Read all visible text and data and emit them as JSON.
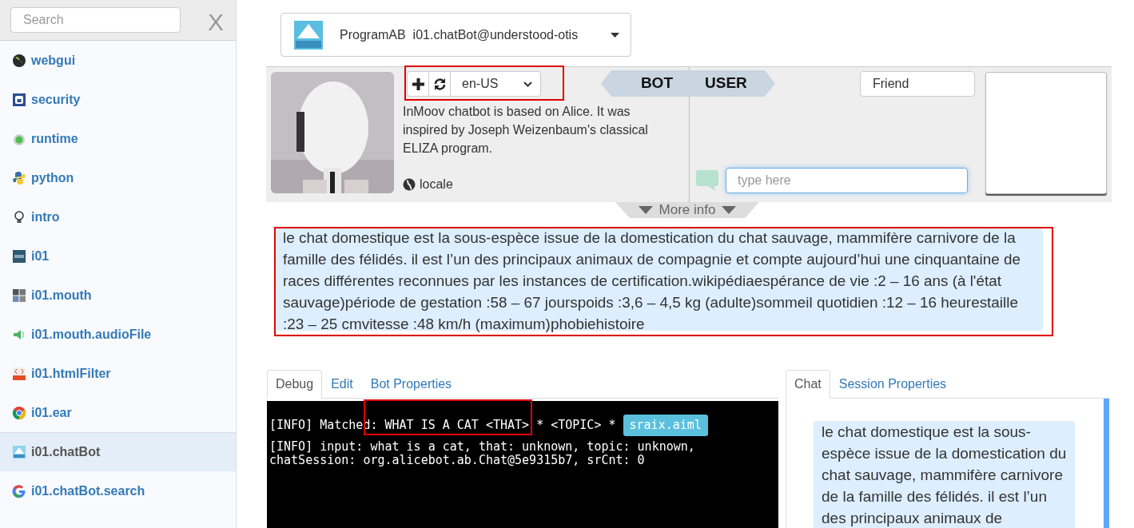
{
  "sidebar": {
    "search": {
      "placeholder": "Search"
    },
    "close": "X",
    "items": [
      {
        "label": "webgui",
        "selected": false
      },
      {
        "label": "security",
        "selected": false
      },
      {
        "label": "runtime",
        "selected": false
      },
      {
        "label": "python",
        "selected": false
      },
      {
        "label": "intro",
        "selected": false
      },
      {
        "label": "i01",
        "selected": false
      },
      {
        "label": "i01.mouth",
        "selected": false
      },
      {
        "label": "i01.mouth.audioFile",
        "selected": false
      },
      {
        "label": "i01.htmlFilter",
        "selected": false
      },
      {
        "label": "i01.ear",
        "selected": false
      },
      {
        "label": "i01.chatBot",
        "selected": true
      },
      {
        "label": "i01.chatBot.search",
        "selected": false
      }
    ]
  },
  "header": {
    "type": "ProgramAB",
    "name": "i01.chatBot@understood-otis"
  },
  "bot_panel": {
    "locale_select": "en-US",
    "description": "InMoov chatbot is based on Alice. It was inspired by Joseph Weizenbaum's classical ELIZA program.",
    "locale_label": "locale",
    "bot_tab": "BOT",
    "user_tab": "USER",
    "username": "Friend",
    "input": {
      "placeholder": "type here"
    },
    "more_info": "More info"
  },
  "response": "le chat domestique est la sous-espèce issue de la domestication du chat sauvage, mammifère carnivore de la famille des félidés. il est l’un des principaux animaux de compagnie et compte aujourd’hui une cinquantaine de races différentes reconnues par les instances de certification.wikipédiaespérance de vie :2 – 16 ans (à l'état sauvage)période de gestation :58 – 67 jourspoids :3,6 – 4,5 kg (adulte)sommeil quotidien :12 – 16 heurestaille :23 – 25 cmvitesse :48 km/h (maximum)phobiehistoire",
  "left_tabs": [
    {
      "label": "Debug",
      "selected": true
    },
    {
      "label": "Edit",
      "selected": false
    },
    {
      "label": "Bot Properties",
      "selected": false
    }
  ],
  "debug_log": [
    {
      "text": "[INFO] Matched: WHAT IS A CAT <THAT> * <TOPIC> * ",
      "file": "sraix.aiml"
    },
    {
      "text": "[INFO] input: what is a cat, that: unknown, topic: unknown,\nchatSession: org.alicebot.ab.Chat@5e9315b7, srCnt: 0"
    }
  ],
  "right_tabs": [
    {
      "label": "Chat",
      "selected": true
    },
    {
      "label": "Session Properties",
      "selected": false
    }
  ],
  "chat_message": "le chat domestique est la sous-espèce issue de la domestication du chat sauvage, mammifère carnivore de la famille des félidés. il est l’un des principaux animaux de"
}
